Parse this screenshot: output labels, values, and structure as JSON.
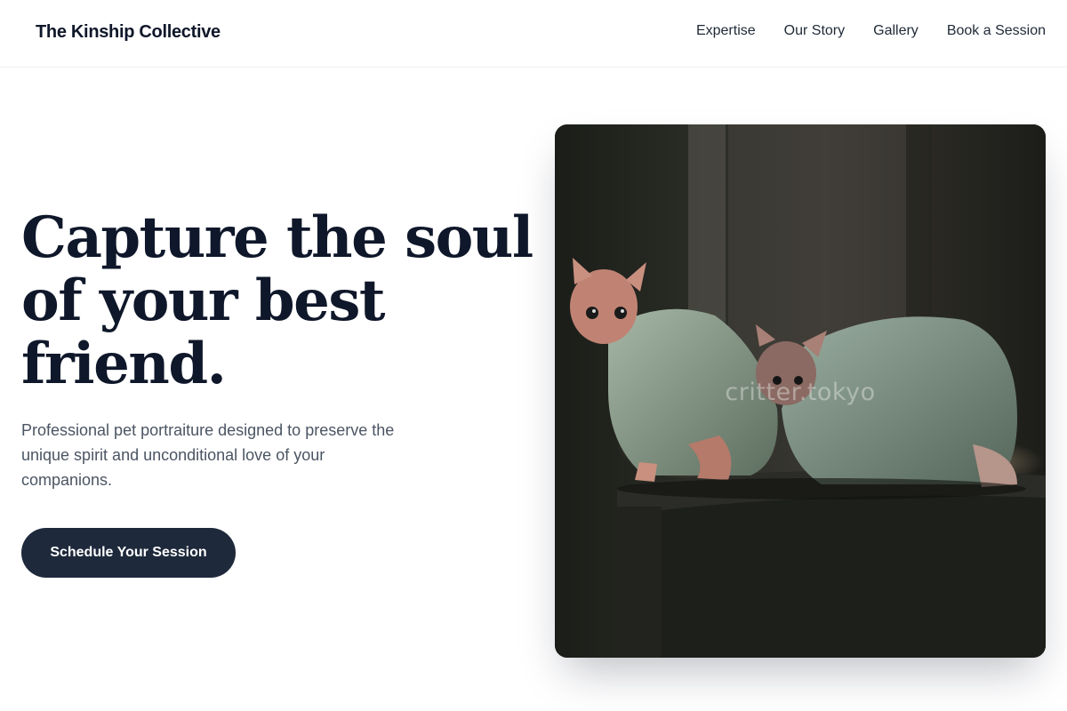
{
  "brand": {
    "name": "The Kinship Collective"
  },
  "nav": {
    "links": [
      {
        "label": "Expertise"
      },
      {
        "label": "Our Story"
      },
      {
        "label": "Gallery"
      },
      {
        "label": "Book a Session"
      }
    ]
  },
  "hero": {
    "title": "Capture the soul of your best friend.",
    "subtitle": "Professional pet portraiture designed to preserve the unique spirit and unconditional love of your companions.",
    "cta_label": "Schedule Your Session"
  },
  "photo": {
    "subject": "two hairless sphynx cats wearing green fleece sweaters on a dark sofa",
    "watermark": "critter.tokyo"
  },
  "colors": {
    "heading": "#0f172a",
    "body_text": "#4b5563",
    "cta_background": "#1e293b",
    "cta_text": "#ffffff"
  }
}
